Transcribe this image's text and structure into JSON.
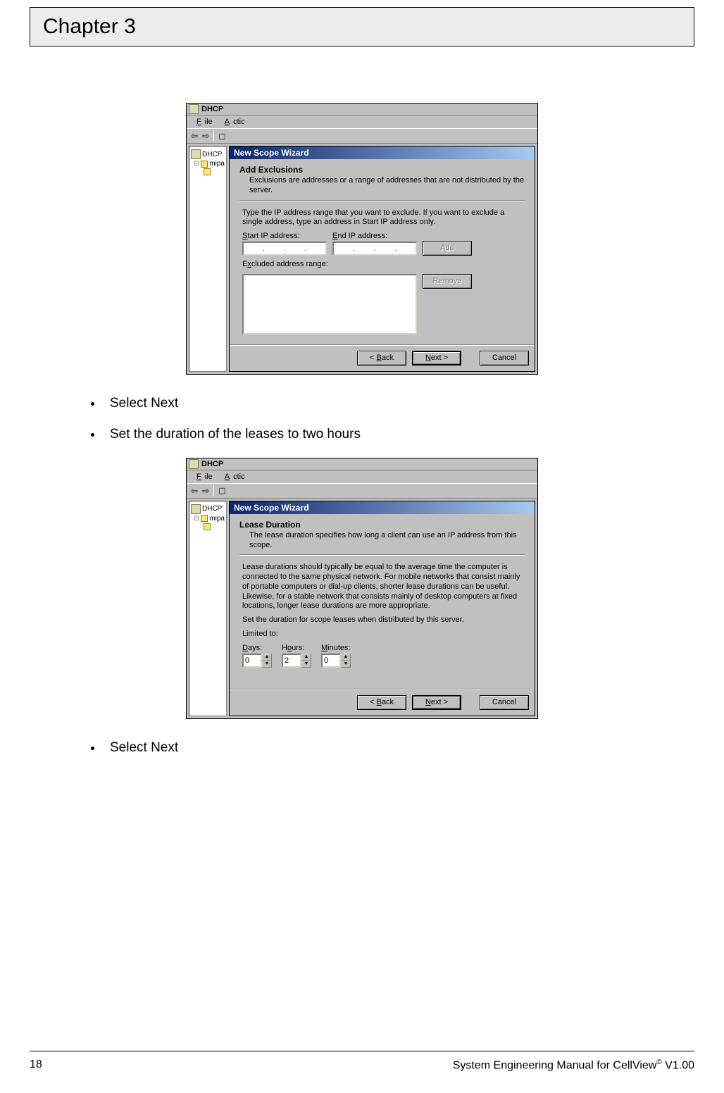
{
  "chapter": {
    "title": "Chapter 3"
  },
  "bullets": {
    "b1": "Select Next",
    "b2": "Set the duration of the leases to two hours",
    "b3": "Select Next"
  },
  "footer": {
    "pagenum": "18",
    "manual_prefix": "System Engineering Manual for CellView",
    "manual_suffix": " V1.00"
  },
  "app": {
    "title": "DHCP",
    "menu_file": "File",
    "menu_action": "Actic"
  },
  "tree": {
    "root": "DHCP",
    "node": "mipa"
  },
  "dlg1": {
    "window_title": "New Scope Wizard",
    "heading": "Add Exclusions",
    "heading_desc": "Exclusions are addresses or a range of addresses that are not distributed by the server.",
    "instructions": "Type the IP address range that you want to exclude. If you want to exclude a single address, type an address in Start IP address only.",
    "label_start": "Start IP address:",
    "label_end": "End IP address:",
    "btn_add": "Add",
    "label_excluded": "Excluded address range:",
    "btn_remove": "Remove",
    "btn_back": "< Back",
    "btn_next": "Next >",
    "btn_cancel": "Cancel"
  },
  "dlg2": {
    "window_title": "New Scope Wizard",
    "heading": "Lease Duration",
    "heading_desc": "The lease duration specifies how long a client can use an IP address from this scope.",
    "para": "Lease durations should typically be equal to the average time the computer is connected to the same physical network. For mobile networks that consist mainly of portable computers or dial-up clients, shorter lease durations can be useful. Likewise, for a stable network that consists mainly of desktop computers at fixed locations, longer lease durations are more appropriate.",
    "set_text": "Set the duration for scope leases when distributed by this server.",
    "limited": "Limited to:",
    "label_days": "Days:",
    "label_hours": "Hours:",
    "label_minutes": "Minutes:",
    "val_days": "0",
    "val_hours": "2",
    "val_minutes": "0",
    "btn_back": "< Back",
    "btn_next": "Next >",
    "btn_cancel": "Cancel"
  }
}
